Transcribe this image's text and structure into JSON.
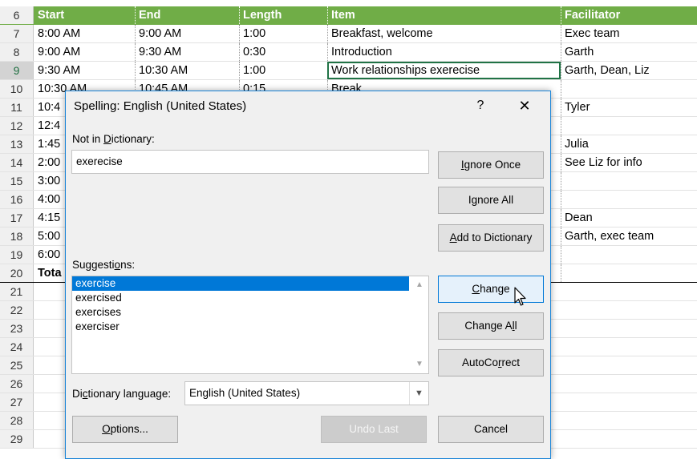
{
  "sheet": {
    "header": {
      "rownum": "6",
      "start": "Start",
      "end": "End",
      "length": "Length",
      "item": "Item",
      "facilitator": "Facilitator"
    },
    "rows": [
      {
        "rownum": "7",
        "start": "8:00 AM",
        "end": "9:00 AM",
        "length": "1:00",
        "item": "Breakfast, welcome",
        "facilitator": "Exec team"
      },
      {
        "rownum": "8",
        "start": "9:00 AM",
        "end": "9:30 AM",
        "length": "0:30",
        "item": "Introduction",
        "facilitator": "Garth"
      },
      {
        "rownum": "9",
        "start": "9:30 AM",
        "end": "10:30 AM",
        "length": "1:00",
        "item": "Work relationships exerecise",
        "facilitator": "Garth, Dean, Liz"
      },
      {
        "rownum": "10",
        "start": "10:30 AM",
        "end": "10:45 AM",
        "length": "0:15",
        "item": "Break",
        "facilitator": ""
      },
      {
        "rownum": "11",
        "start": "10:4",
        "end": "",
        "length": "",
        "item": "",
        "facilitator": "Tyler"
      },
      {
        "rownum": "12",
        "start": "12:4",
        "end": "",
        "length": "",
        "item": "",
        "facilitator": ""
      },
      {
        "rownum": "13",
        "start": "1:45",
        "end": "",
        "length": "",
        "item": "",
        "facilitator": "Julia"
      },
      {
        "rownum": "14",
        "start": "2:00",
        "end": "",
        "length": "",
        "item": "",
        "facilitator": "See Liz for info"
      },
      {
        "rownum": "15",
        "start": "3:00",
        "end": "",
        "length": "",
        "item": "",
        "facilitator": ""
      },
      {
        "rownum": "16",
        "start": "4:00",
        "end": "",
        "length": "",
        "item": "",
        "facilitator": ""
      },
      {
        "rownum": "17",
        "start": "4:15",
        "end": "",
        "length": "",
        "item": "",
        "facilitator": "Dean"
      },
      {
        "rownum": "18",
        "start": "5:00",
        "end": "",
        "length": "",
        "item": "",
        "facilitator": "Garth, exec team"
      },
      {
        "rownum": "19",
        "start": "6:00",
        "end": "",
        "length": "",
        "item": "",
        "facilitator": ""
      }
    ],
    "total": {
      "rownum": "20",
      "label": "Tota"
    },
    "empty_rows": [
      "21",
      "22",
      "23",
      "24",
      "25",
      "26",
      "27",
      "28",
      "29"
    ]
  },
  "dialog": {
    "title": "Spelling: English (United States)",
    "help_label": "?",
    "close_label": "✕",
    "not_in_dictionary_label": {
      "pre": "Not in ",
      "underlined": "D",
      "post": "ictionary:"
    },
    "not_in_dictionary_value": "exerecise",
    "suggestions_label": {
      "pre": "Suggesti",
      "underlined": "o",
      "post": "ns:"
    },
    "suggestions": [
      "exercise",
      "exercised",
      "exercises",
      "exerciser"
    ],
    "selected_suggestion": "exercise",
    "dictionary_language_label": {
      "pre": "Di",
      "underlined": "c",
      "post": "tionary language:"
    },
    "dictionary_language_value": "English (United States)",
    "buttons": {
      "ignore_once": {
        "pre": "",
        "underlined": "I",
        "post": "gnore Once"
      },
      "ignore_all": {
        "pre": "I",
        "underlined": "g",
        "post": "nore All"
      },
      "add_to_dictionary": {
        "pre": "",
        "underlined": "A",
        "post": "dd to Dictionary"
      },
      "change": {
        "pre": "",
        "underlined": "C",
        "post": "hange"
      },
      "change_all": {
        "pre": "Change A",
        "underlined": "l",
        "post": "l"
      },
      "autocorrect": {
        "pre": "AutoCo",
        "underlined": "r",
        "post": "rect"
      },
      "options": {
        "pre": "",
        "underlined": "O",
        "post": "ptions..."
      },
      "undo_last": "Undo Last",
      "cancel": "Cancel"
    }
  },
  "colors": {
    "header_green": "#70ad47",
    "selection_blue": "#0078d7",
    "dialog_border": "#1883d7"
  },
  "icons": [
    "question-icon",
    "close-icon",
    "scroll-up-icon",
    "scroll-down-icon",
    "dropdown-arrow-icon",
    "mouse-pointer-icon"
  ]
}
